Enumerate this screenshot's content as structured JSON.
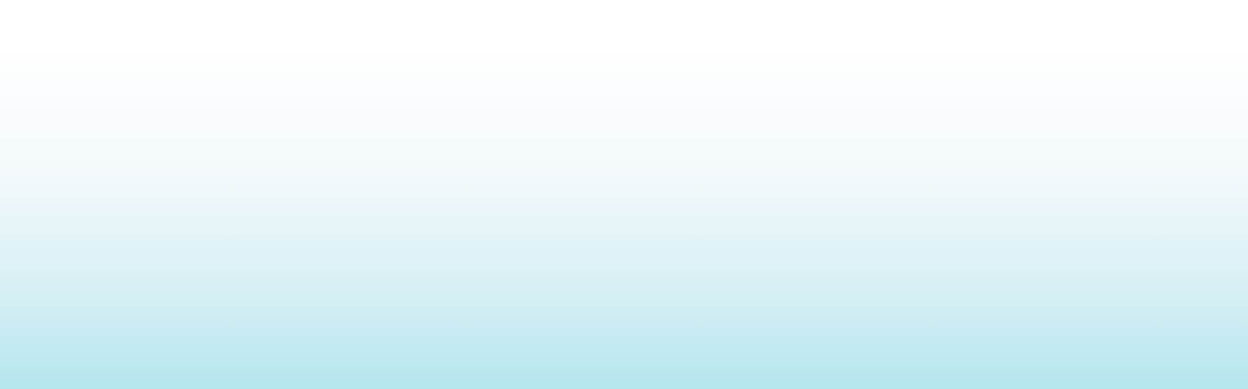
{
  "background": {
    "top_color": "#ffffff",
    "bottom_color": "#b4e5ee"
  }
}
